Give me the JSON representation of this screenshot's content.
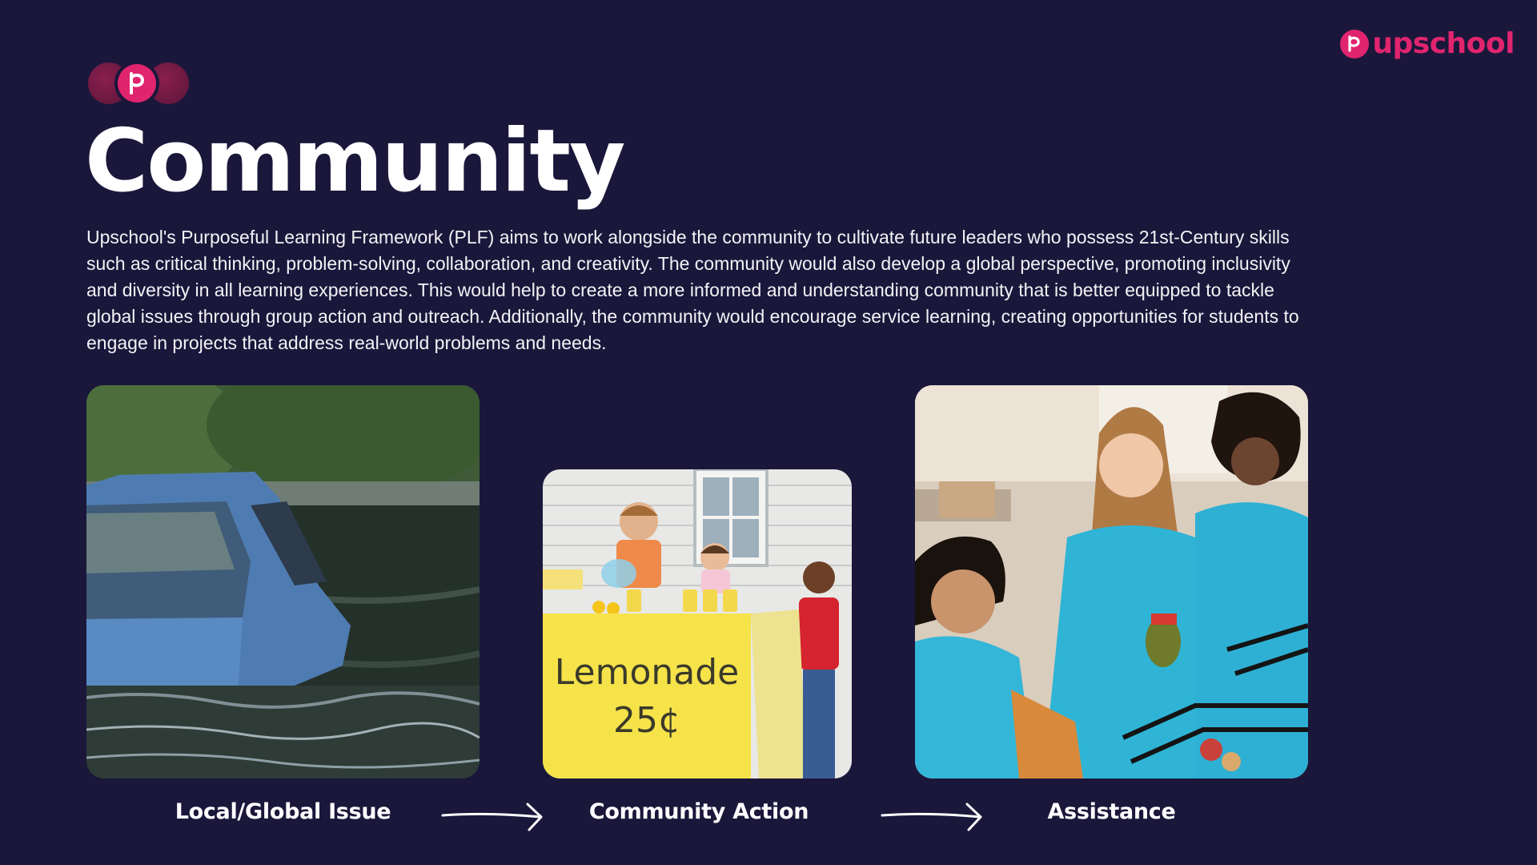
{
  "brand": {
    "logo_text": "upschool",
    "color": "#e0246e"
  },
  "header": {
    "badge_icon": "globe-badge-icon",
    "title": "Community"
  },
  "intro": {
    "text": "Upschool's Purposeful Learning Framework (PLF) aims to work alongside the community to cultivate future leaders who possess 21st-Century skills such as critical thinking, problem-solving, collaboration, and creativity. The community would also develop a global perspective, promoting inclusivity and diversity in all learning experiences. This would help to create a more informed and understanding community that is better equipped to tackle global issues through group action and outreach. Additionally, the community would encourage service learning, creating opportunities for students to engage in projects that address real-world problems and needs."
  },
  "steps": [
    {
      "label": "Local/Global Issue",
      "image": "flooded-car-photo"
    },
    {
      "label": "Community Action",
      "image": "lemonade-stand-photo",
      "sign_line1": "Lemonade",
      "sign_line2": "25¢"
    },
    {
      "label": "Assistance",
      "image": "volunteers-photo"
    }
  ],
  "colors": {
    "background": "#1a173b",
    "accent": "#e0246e",
    "text": "#ffffff"
  }
}
